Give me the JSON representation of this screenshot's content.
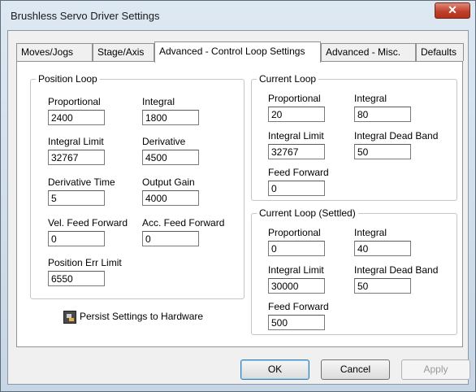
{
  "window": {
    "title": "Brushless Servo Driver Settings",
    "close_glyph": "✕"
  },
  "tabs": [
    {
      "label": "Moves/Jogs",
      "active": false
    },
    {
      "label": "Stage/Axis",
      "active": false
    },
    {
      "label": "Advanced - Control Loop Settings",
      "active": true
    },
    {
      "label": "Advanced - Misc.",
      "active": false
    },
    {
      "label": "Defaults",
      "active": false
    }
  ],
  "position_loop": {
    "title": "Position Loop",
    "proportional": {
      "label": "Proportional",
      "value": "2400"
    },
    "integral": {
      "label": "Integral",
      "value": "1800"
    },
    "integral_limit": {
      "label": "Integral Limit",
      "value": "32767"
    },
    "derivative": {
      "label": "Derivative",
      "value": "4500"
    },
    "derivative_time": {
      "label": "Derivative Time",
      "value": "5"
    },
    "output_gain": {
      "label": "Output Gain",
      "value": "4000"
    },
    "vel_feed_forward": {
      "label": "Vel. Feed Forward",
      "value": "0"
    },
    "acc_feed_forward": {
      "label": "Acc. Feed Forward",
      "value": "0"
    },
    "position_err_limit": {
      "label": "Position Err Limit",
      "value": "6550"
    }
  },
  "current_loop": {
    "title": "Current Loop",
    "proportional": {
      "label": "Proportional",
      "value": "20"
    },
    "integral": {
      "label": "Integral",
      "value": "80"
    },
    "integral_limit": {
      "label": "Integral Limit",
      "value": "32767"
    },
    "integral_dead_band": {
      "label": "Integral Dead Band",
      "value": "50"
    },
    "feed_forward": {
      "label": "Feed Forward",
      "value": "0"
    }
  },
  "current_loop_settled": {
    "title": "Current Loop (Settled)",
    "proportional": {
      "label": "Proportional",
      "value": "0"
    },
    "integral": {
      "label": "Integral",
      "value": "40"
    },
    "integral_limit": {
      "label": "Integral Limit",
      "value": "30000"
    },
    "integral_dead_band": {
      "label": "Integral Dead Band",
      "value": "50"
    },
    "feed_forward": {
      "label": "Feed Forward",
      "value": "500"
    }
  },
  "persist": {
    "label": "Persist Settings to Hardware",
    "icon": "hardware-save-icon"
  },
  "buttons": {
    "ok": "OK",
    "cancel": "Cancel",
    "apply": "Apply"
  }
}
